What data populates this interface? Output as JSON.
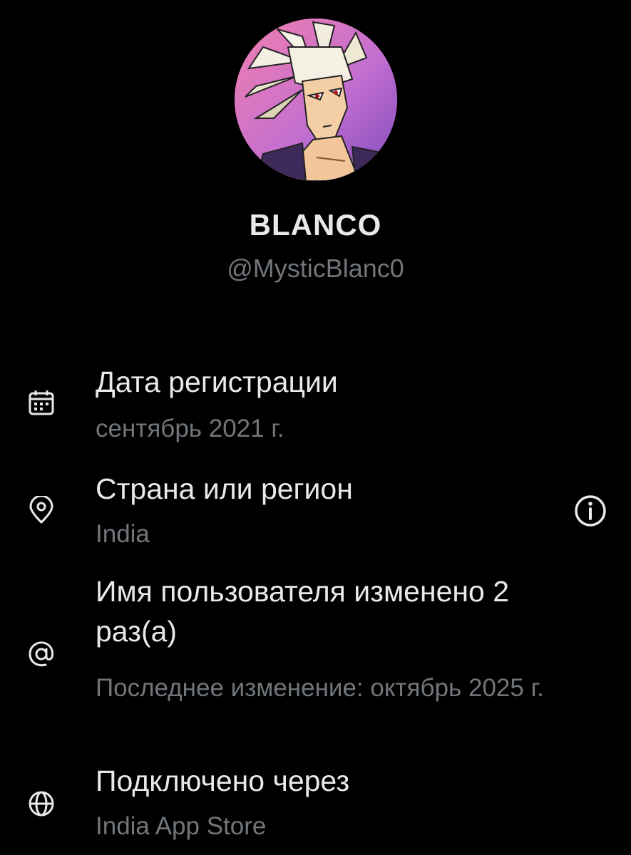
{
  "profile": {
    "display_name": "BLANCO",
    "handle": "@MysticBlanc0",
    "avatar_icon": "anime-character-avatar"
  },
  "details": [
    {
      "icon": "calendar-icon",
      "title": "Дата регистрации",
      "value": "сентябрь 2021 г."
    },
    {
      "icon": "location-pin-icon",
      "title": "Страна или регион",
      "value": "India",
      "action_icon": "info-icon"
    },
    {
      "icon": "at-sign-icon",
      "title": "Имя пользователя изменено 2 раз(а)",
      "value": "Последнее изменение: октябрь 2025 г."
    },
    {
      "icon": "globe-icon",
      "title": "Подключено через",
      "value": "India App Store"
    }
  ],
  "colors": {
    "background": "#000000",
    "primary_text": "#e7e9ea",
    "secondary_text": "#71767b"
  }
}
